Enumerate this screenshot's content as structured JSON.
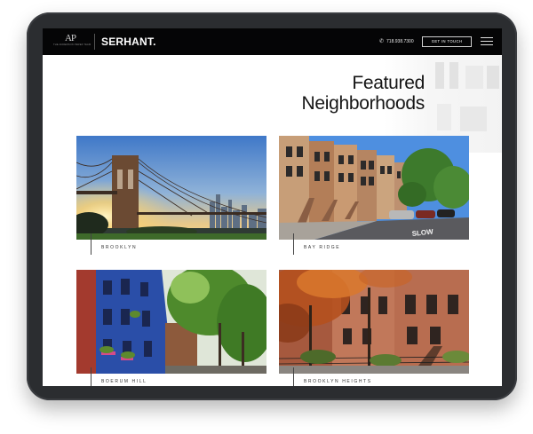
{
  "header": {
    "logo_monogram": "AP",
    "logo_tagline": "THE ANDERSON PEREZ TEAM",
    "brand": "SERHANT.",
    "phone": "718.938.7300",
    "cta_label": "GET IN TOUCH"
  },
  "page": {
    "heading_line1": "Featured",
    "heading_line2": "Neighborhoods"
  },
  "neighborhoods": [
    {
      "label": "BROOKLYN"
    },
    {
      "label": "BAY RIDGE"
    },
    {
      "label": "BOERUM HILL"
    },
    {
      "label": "BROOKLYN HEIGHTS"
    }
  ],
  "icons": {
    "phone": "phone-icon",
    "menu": "hamburger-menu-icon"
  },
  "colors": {
    "header_bg": "#050506",
    "device_frame": "#2b2d30",
    "text": "#151515"
  }
}
